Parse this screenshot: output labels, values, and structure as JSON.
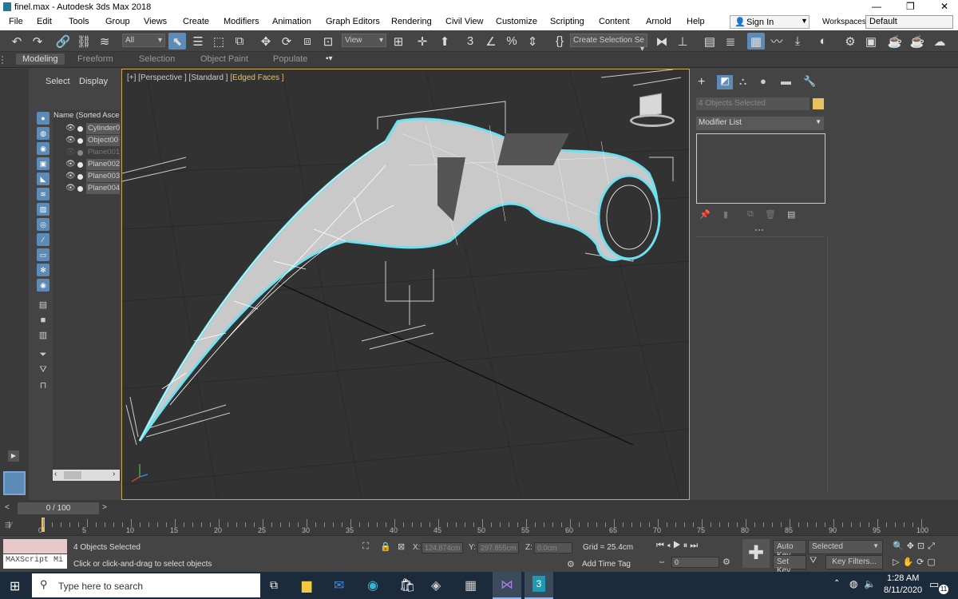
{
  "window": {
    "title": "finel.max - Autodesk 3ds Max 2018",
    "controls": [
      "—",
      "❐",
      "✕"
    ]
  },
  "menubar": {
    "items": [
      "File",
      "Edit",
      "Tools",
      "Group",
      "Views",
      "Create",
      "Modifiers",
      "Animation",
      "Graph Editors",
      "Rendering",
      "Civil View",
      "Customize",
      "Scripting",
      "Content",
      "Arnold",
      "Help"
    ],
    "sign_in": "Sign In",
    "workspaces_label": "Workspaces:",
    "workspace": "Default"
  },
  "toolbar": {
    "filter": "All",
    "ref_coord": "View",
    "named_selection": "Create Selection Se"
  },
  "ribbon": {
    "tabs": [
      "Modeling",
      "Freeform",
      "Selection",
      "Object Paint",
      "Populate"
    ]
  },
  "scene_explorer": {
    "tabs": [
      "Select",
      "Display"
    ],
    "header": "Name (Sorted Ascen",
    "objects": [
      "Cylinder0",
      "Object00",
      "Plane001",
      "Plane002",
      "Plane003",
      "Plane004"
    ]
  },
  "viewport": {
    "label_prefix": "[+] [Perspective ] [Standard ]",
    "label_mode": "[Edged Faces ]",
    "accent": "#c9a650"
  },
  "command_panel": {
    "selection_field": "4 Objects Selected",
    "modifier_list": "Modifier List"
  },
  "timeline": {
    "frame_display": "0 / 100",
    "ticks": [
      "0",
      "5",
      "10",
      "15",
      "20",
      "25",
      "30",
      "35",
      "40",
      "45",
      "50",
      "55",
      "60",
      "65",
      "70",
      "75",
      "80",
      "85",
      "90",
      "95",
      "100"
    ],
    "current_frame": 0,
    "total_frames": 100
  },
  "status": {
    "maxscript": "MAXScript Mi",
    "selection": "4 Objects Selected",
    "prompt": "Click or click-and-drag to select objects",
    "x_label": "X:",
    "x_value": "124.874cm",
    "y_label": "Y:",
    "y_value": "297.855cm",
    "z_label": "Z:",
    "z_value": "0.0cm",
    "grid": "Grid = 25.4cm",
    "add_time_tag": "Add Time Tag",
    "auto_key": "Auto Key",
    "key_mode": "Selected",
    "set_key": "Set Key",
    "key_filters": "Key Filters...",
    "frame_field": "0"
  },
  "taskbar": {
    "search_placeholder": "Type here to search",
    "time": "1:28 AM",
    "date": "8/11/2020",
    "notif_count": "11"
  }
}
